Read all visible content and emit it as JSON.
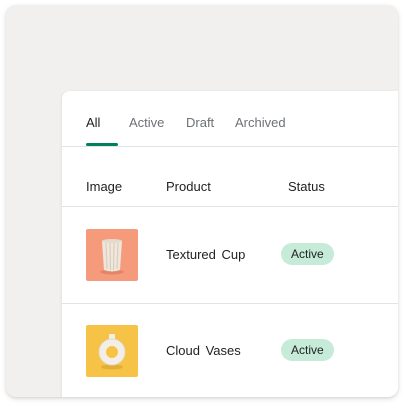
{
  "tabs": [
    {
      "label": "All",
      "selected": true
    },
    {
      "label": "Active"
    },
    {
      "label": "Draft"
    },
    {
      "label": "Archived"
    }
  ],
  "table": {
    "headers": {
      "image": "Image",
      "product": "Product",
      "status": "Status"
    },
    "rows": [
      {
        "product": "Textured Cup",
        "status": "Active",
        "thumb_bg": "#f59b7c",
        "image_icon": "textured-cup-icon"
      },
      {
        "product": "Cloud Vases",
        "status": "Active",
        "thumb_bg": "#f7c347",
        "image_icon": "cloud-vase-icon"
      }
    ]
  },
  "colors": {
    "accent": "#008060",
    "badge_active_bg": "#c6ebd8",
    "frame_bg": "#f1f0ee"
  }
}
